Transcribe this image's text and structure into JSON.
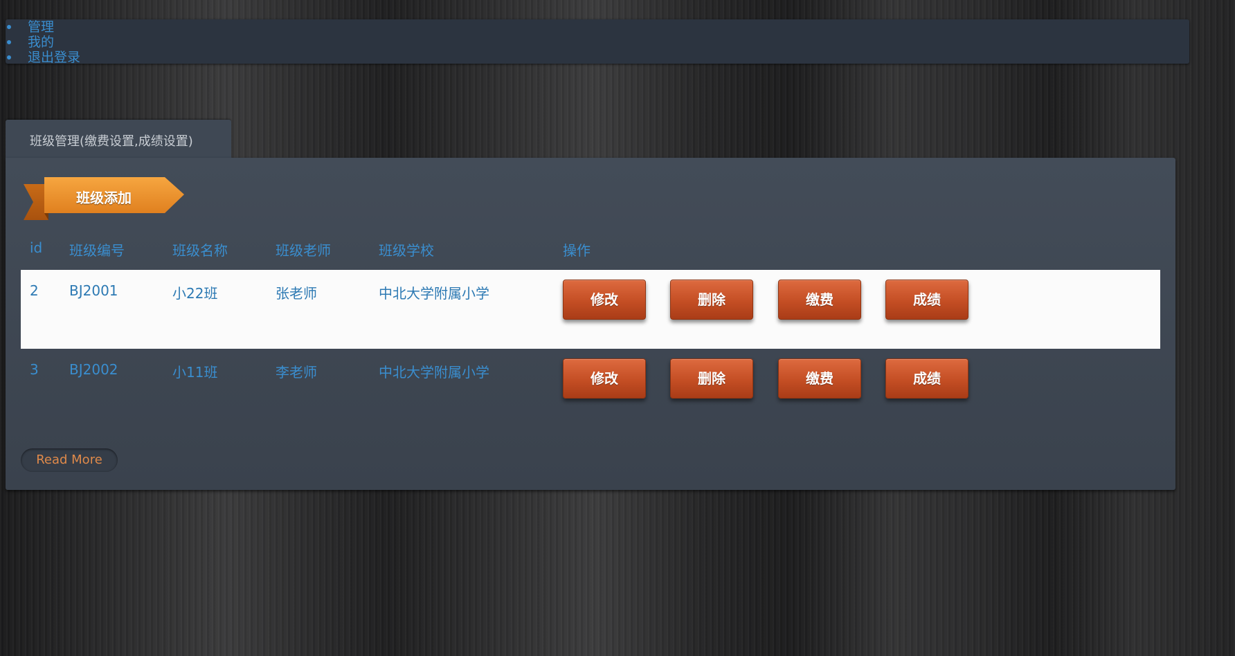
{
  "nav": {
    "items": [
      {
        "label": "管理"
      },
      {
        "label": "我的"
      },
      {
        "label": "退出登录"
      }
    ]
  },
  "tab": {
    "label": "班级管理(缴费设置,成绩设置)"
  },
  "ribbon": {
    "label": "班级添加"
  },
  "table": {
    "headers": [
      "id",
      "班级编号",
      "班级名称",
      "班级老师",
      "班级学校",
      "操作"
    ],
    "rows": [
      {
        "id": "2",
        "code": "BJ2001",
        "name": "小22班",
        "teacher": "张老师",
        "school": "中北大学附属小学"
      },
      {
        "id": "3",
        "code": "BJ2002",
        "name": "小11班",
        "teacher": "李老师",
        "school": "中北大学附属小学"
      }
    ],
    "actions": {
      "edit": "修改",
      "delete": "删除",
      "fee": "缴费",
      "score": "成绩"
    }
  },
  "read_more": "Read More",
  "colors": {
    "link_blue": "#3a8ecf",
    "button_orange": "#c44e24",
    "ribbon_orange": "#f0962c",
    "panel": "#3c4450"
  }
}
